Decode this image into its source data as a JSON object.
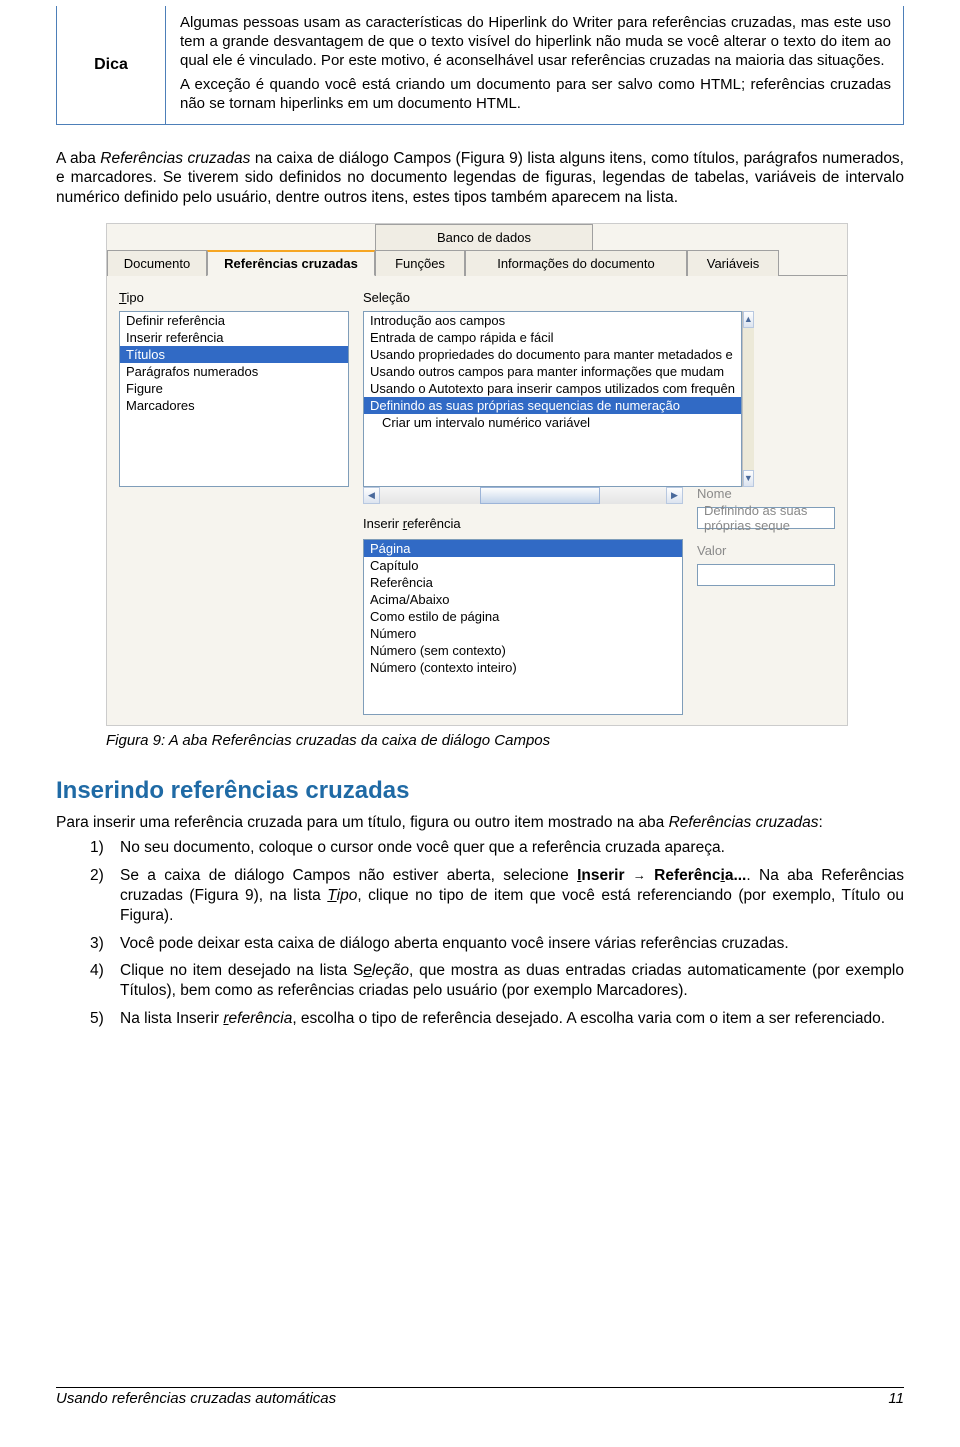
{
  "dica": {
    "label": "Dica",
    "p1": "Algumas pessoas usam as características do Hiperlink do Writer para referências cruzadas, mas este uso tem a grande desvantagem de que o texto visível do hiperlink não muda se você alterar o texto do item ao qual ele é vinculado. Por este motivo, é aconselhável usar referências cruzadas na maioria das situações.",
    "p2": "A exceção é quando você está criando um documento para ser salvo como HTML; referências cruzadas não se tornam hiperlinks em um documento HTML."
  },
  "intro": "A aba Referências cruzadas na caixa de diálogo Campos (Figura 9) lista alguns itens, como títulos, parágrafos numerados, e marcadores. Se tiverem sido definidos no documento legendas de figuras, legendas de tabelas, variáveis de intervalo numérico definido pelo usuário, dentre outros itens, estes tipos também aparecem na lista.",
  "dlg": {
    "tab_top": "Banco de dados",
    "tabs": [
      "Documento",
      "Referências cruzadas",
      "Funções",
      "Informações do documento",
      "Variáveis"
    ],
    "tipo_label_pre": "T",
    "tipo_label_rest": "ipo",
    "selecao_label_pre": "S",
    "selecao_label_rest": "eleção",
    "tipo_items": [
      "Definir referência",
      "Inserir referência",
      "Títulos",
      "Parágrafos numerados",
      "Figure",
      "Marcadores"
    ],
    "tipo_selected": 2,
    "selecao_items": [
      "Introdução aos campos",
      "Entrada de campo rápida e fácil",
      "Usando propriedades do documento para manter metadados e",
      "Usando outros campos para manter informações que mudam",
      "Usando o Autotexto para inserir campos utilizados com frequên",
      "Definindo as suas próprias sequencias de numeração",
      "Criar um intervalo numérico variável"
    ],
    "selecao_selected": 5,
    "inserir_label_pre": "Inserir ",
    "inserir_label_u": "r",
    "inserir_label_rest": "eferência",
    "inserir_items": [
      "Página",
      "Capítulo",
      "Referência",
      "Acima/Abaixo",
      "Como estilo de página",
      "Número",
      "Número (sem contexto)",
      "Número (contexto inteiro)"
    ],
    "inserir_selected": 0,
    "nome_label": "Nome",
    "nome_value": "Definindo as suas próprias seque",
    "valor_label": "Valor"
  },
  "caption": "Figura 9: A aba Referências cruzadas da caixa de diálogo Campos",
  "h2": "Inserindo referências cruzadas",
  "lead": "Para inserir uma referência cruzada para um título, figura ou outro item mostrado na aba Referências cruzadas:",
  "steps": {
    "s1": "No seu documento, coloque o cursor onde você quer que a referência cruzada apareça.",
    "s2a": "Se a caixa de diálogo Campos não estiver aberta, selecione ",
    "s2_ins_u": "I",
    "s2_ins_rest": "nserir",
    "s2_ref_pre": "Referênc",
    "s2_ref_u": "i",
    "s2_ref_rest": "a...",
    "s2b": ". Na aba Referências cruzadas (Figura 9), na lista ",
    "s2_tipo_u": "T",
    "s2_tipo_rest": "ipo",
    "s2c": ", clique no tipo de item que você está referenciando (por exemplo, Título ou Figura).",
    "s3": "Você pode deixar esta caixa de diálogo aberta enquanto você insere várias referências cruzadas.",
    "s4a": "Clique no item desejado na lista S",
    "s4_u": "e",
    "s4_rest": "leção",
    "s4b": ", que mostra as duas entradas criadas automaticamente (por exemplo Títulos), bem como as referências criadas pelo usuário (por exemplo Marcadores).",
    "s5a": "Na lista Inserir ",
    "s5_u": "r",
    "s5_rest": "eferência",
    "s5b": ", escolha o tipo de referência desejado. A escolha varia com o item a ser referenciado."
  },
  "footer": {
    "left": "Usando referências cruzadas automáticas",
    "right": "11"
  }
}
